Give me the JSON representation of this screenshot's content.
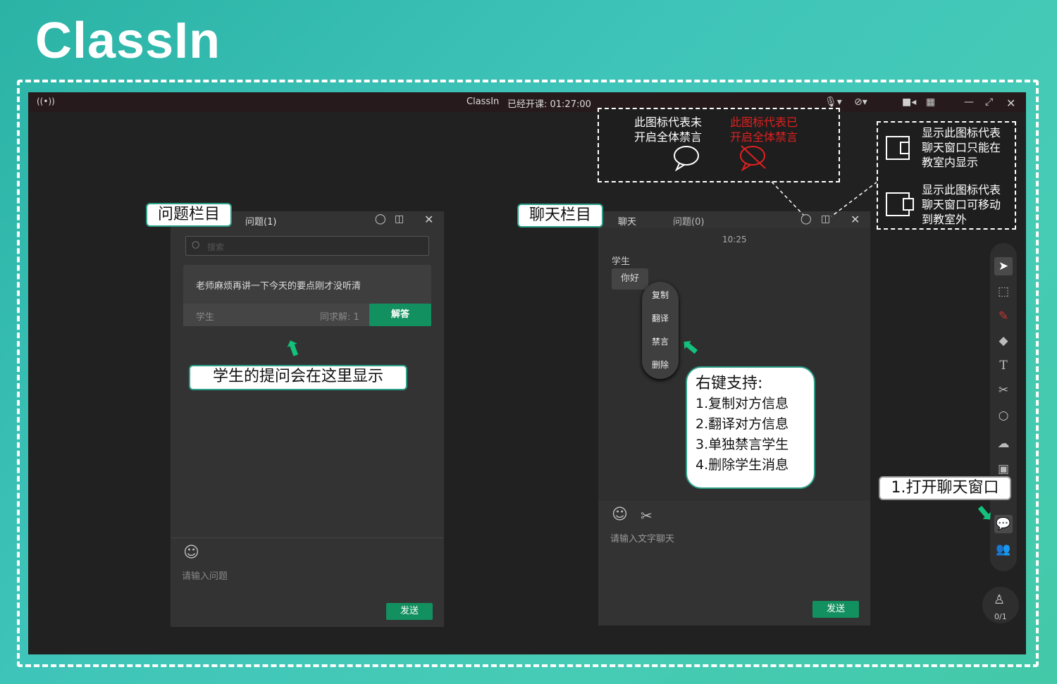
{
  "brand": {
    "logo": "ClassIn"
  },
  "titlebar": {
    "app_name": "ClassIn",
    "status": "已经开课: 01:27:00"
  },
  "question_panel": {
    "title": "问题(1)",
    "search_placeholder": "搜索",
    "question_text": "老师麻烦再讲一下今天的要点刚才没听清",
    "asker": "学生",
    "same_question": "同求解: 1",
    "answer_button": "解答",
    "input_placeholder": "请输入问题",
    "send_button": "发送"
  },
  "chat_panel": {
    "tab_chat": "聊天",
    "tab_questions": "问题(0)",
    "time": "10:25",
    "sender": "学生",
    "message": "你好",
    "context_menu": [
      "复制",
      "翻译",
      "禁言",
      "删除"
    ],
    "input_placeholder": "请输入文字聊天",
    "send_button": "发送"
  },
  "annotations": {
    "question_column": "问题栏目",
    "chat_column": "聊天栏目",
    "question_display": "学生的提问会在这里显示",
    "mute_off_line1": "此图标代表未",
    "mute_off_line2": "开启全体禁言",
    "mute_on_line1": "此图标代表已",
    "mute_on_line2": "开启全体禁言",
    "inside_line1": "显示此图标代表",
    "inside_line2": "聊天窗口只能在",
    "inside_line3": "教室内显示",
    "outside_line1": "显示此图标代表",
    "outside_line2": "聊天窗口可移动",
    "outside_line3": "到教室外",
    "right_click_title": "右键支持:",
    "right_click_items": [
      "1.复制对方信息",
      "2.翻译对方信息",
      "3.单独禁言学生",
      "4.删除学生消息"
    ],
    "open_chat": "1.打开聊天窗口"
  },
  "seat_counter": "0/1",
  "colors": {
    "accent_green": "#13905f",
    "warning_red": "#e02020",
    "frame_teal": "#2a9e86"
  }
}
